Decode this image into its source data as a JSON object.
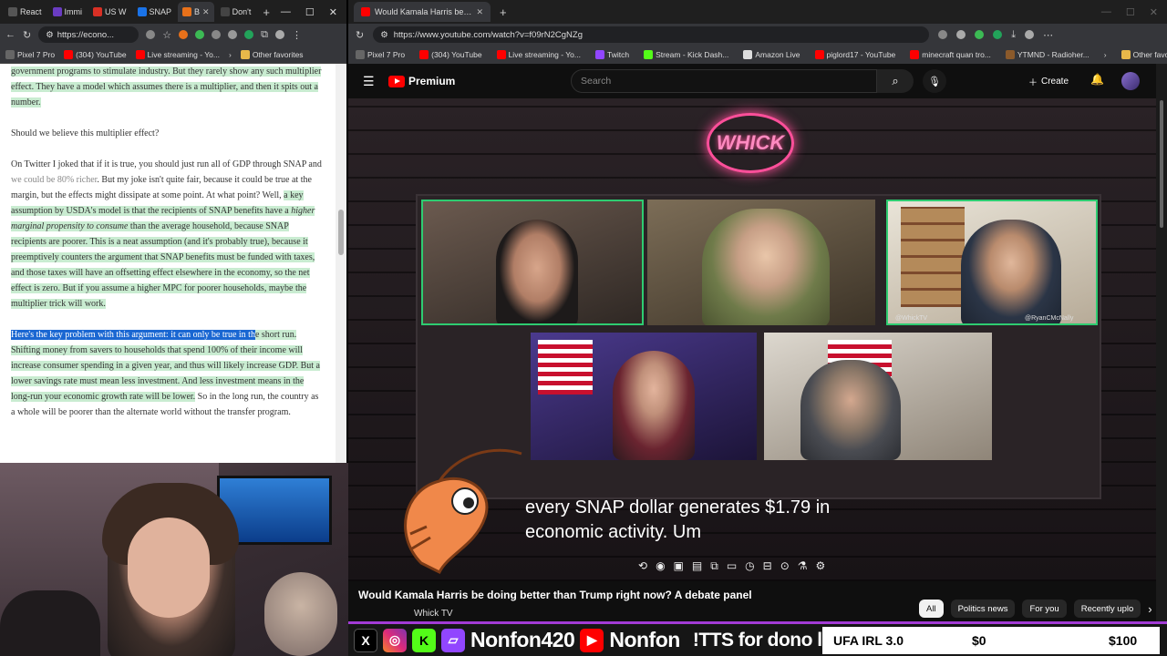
{
  "left_browser": {
    "tabs": [
      {
        "label": "React",
        "color": "#555555"
      },
      {
        "label": "Immi",
        "color": "#6a3cc2"
      },
      {
        "label": "US W",
        "color": "#d93025"
      },
      {
        "label": "SNAP",
        "color": "#1a73e8"
      },
      {
        "label": "B",
        "color": "#e8711a"
      },
      {
        "label": "Don't",
        "color": "#444444"
      }
    ],
    "url": "https://econo...",
    "bookmarks": [
      "Pixel 7 Pro",
      "(304) YouTube",
      "Live streaming - Yo...",
      "Other favorites"
    ],
    "article": {
      "p1_pre": "government programs to stimulate industry. But they rarely show any such multiplier effect. They have a model which assumes there is a multiplier, and then it spits out a number.",
      "p2": "Should we believe this multiplier effect?",
      "p3_a": "On Twitter I joked that if it is true, you should just run all of GDP through SNAP and ",
      "p3_link": "we could be 80% richer",
      "p3_b": ". But my joke isn't quite fair, because it could be true at the margin, but the effects might dissipate at some point. At what point? Well, ",
      "p3_hl_a": "a key assumption by USDA's model is that the recipients of SNAP benefits have a ",
      "p3_hl_em": "higher marginal propensity to consume",
      "p3_hl_b": " than the average household, because SNAP recipients are poorer. This is a neat assumption (and it's probably true), because it preemptively counters the argument that SNAP benefits must be funded with taxes, and those taxes will have an offsetting effect elsewhere in the economy, so the net effect is zero. But if you assume a higher MPC for poorer households, maybe the multiplier trick will work.",
      "p4_sel": "Here's the key problem with this argument: it can only be true in th",
      "p4_hl": "e short run. Shifting money from savers to households that spend 100% of their income will increase consumer spending in a given year, and thus will likely increase GDP. But a lower savings rate must mean less investment. And less investment means in the long-run your economic growth rate will be lower.",
      "p4_end": " So in the long run, the country as a whole will be poorer than the alternate world without the transfer program."
    }
  },
  "right_browser": {
    "tab_title": "Would Kamala Harris be doing be",
    "url": "https://www.youtube.com/watch?v=f09rN2CgNZg",
    "bookmarks": [
      "Pixel 7 Pro",
      "(304) YouTube",
      "Live streaming - Yo...",
      "Twitch",
      "Stream - Kick Dash...",
      "Amazon Live",
      "piglord17 - YouTube",
      "minecraft quan tro...",
      "YTMND - Radioher...",
      "Other favorites"
    ],
    "youtube": {
      "logo": "Premium",
      "search_placeholder": "Search",
      "create_label": "Create",
      "neon_sign": "WHICK",
      "cam_names": [
        "@WhickTV",
        "@RyanCMcNally"
      ],
      "subtitle_line1": "every SNAP dollar generates $1.79 in",
      "subtitle_line2": "economic activity. Um",
      "video_title": "Would Kamala Harris be doing better than Trump right now? A debate panel",
      "channel": "Whick TV",
      "chips": [
        "All",
        "Politics news",
        "For you",
        "Recently uplo"
      ]
    }
  },
  "overlay": {
    "handle1": "Nonfon420",
    "handle2": "Nonfon",
    "tts": "!TTS for dono link",
    "goal_label": "UFA IRL 3.0",
    "goal_current": "$0",
    "goal_target": "$100",
    "accent": "#a23bd6"
  }
}
